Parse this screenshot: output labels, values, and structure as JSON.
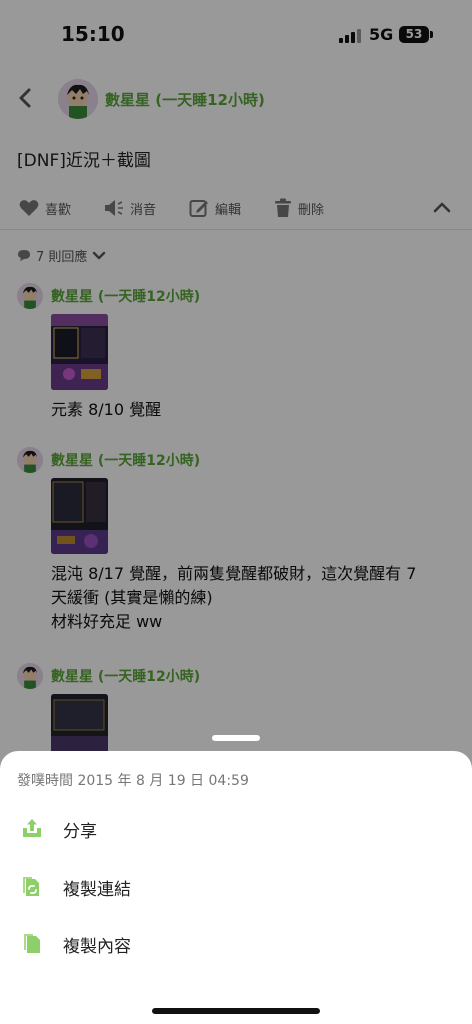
{
  "status_bar": {
    "time": "15:10",
    "network": "5G",
    "battery": "53"
  },
  "header": {
    "author": "數星星 (一天睡12小時)"
  },
  "post": {
    "title": "[DNF]近況＋截圖"
  },
  "actions": {
    "like": "喜歡",
    "mute": "消音",
    "edit": "編輯",
    "delete": "刪除"
  },
  "replies": {
    "count_label": "7 則回應",
    "items": [
      {
        "author": "數星星 (一天睡12小時)",
        "text_lines": [
          "元素 8/10 覺醒"
        ]
      },
      {
        "author": "數星星 (一天睡12小時)",
        "text_lines": [
          "混沌 8/17 覺醒，前兩隻覺醒都破財，這次覺醒有 7",
          "天緩衝 (其實是懶的練)",
          "材料好充足 ww"
        ]
      },
      {
        "author": "數星星 (一天睡12小時)",
        "text_lines": []
      }
    ]
  },
  "sheet": {
    "posted_time": "發噗時間 2015 年 8 月 19 日 04:59",
    "items": [
      {
        "label": "分享",
        "icon": "share-icon"
      },
      {
        "label": "複製連結",
        "icon": "copy-link-icon"
      },
      {
        "label": "複製內容",
        "icon": "copy-content-icon"
      }
    ]
  },
  "colors": {
    "accent_green": "#5aa53a",
    "icon_green": "#8fcf6a",
    "overlay": "rgba(0,0,0,0.40)"
  }
}
